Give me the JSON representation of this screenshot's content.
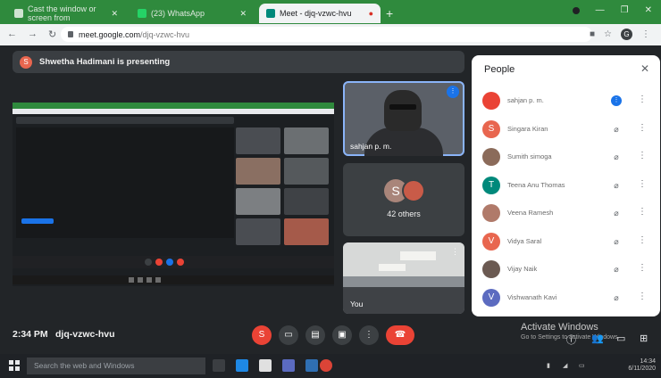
{
  "browser": {
    "tabs": [
      {
        "label": "Cast the window or screen from"
      },
      {
        "label": "(23) WhatsApp"
      },
      {
        "label": "Meet - djq-vzwc-hvu"
      }
    ],
    "url_host": "meet.google.com",
    "url_path": "/djq-vzwc-hvu"
  },
  "meet": {
    "presenting_text": "Shwetha Hadimani is presenting",
    "presenter_initial": "S",
    "tiles": {
      "speaker_name": "sahjan p. m.",
      "others_initial": "S",
      "others_label": "42 others",
      "self_name": "You"
    },
    "time": "2:34 PM",
    "meeting_code": "djq-vzwc-hvu",
    "controls": [
      "caption",
      "camera",
      "present",
      "share",
      "more",
      "hangup"
    ],
    "activate": {
      "title": "Activate Windows",
      "subtitle": "Go to Settings to activate Windows."
    }
  },
  "people": {
    "title": "People",
    "participants": [
      {
        "name": "sahjan p. m.",
        "initial": "",
        "color": "#ea4335",
        "mic": "on"
      },
      {
        "name": "Singara Kiran",
        "initial": "S",
        "color": "#e8664f",
        "mic": "off"
      },
      {
        "name": "Sumith simoga",
        "initial": "",
        "color": "#8b6b5a",
        "mic": "off"
      },
      {
        "name": "Teena Anu Thomas",
        "initial": "T",
        "color": "#00897b",
        "mic": "off"
      },
      {
        "name": "Veena Ramesh",
        "initial": "",
        "color": "#b07a6a",
        "mic": "off"
      },
      {
        "name": "Vidya Saral",
        "initial": "V",
        "color": "#e8664f",
        "mic": "off"
      },
      {
        "name": "Vijay Naik",
        "initial": "",
        "color": "#6b5a52",
        "mic": "off"
      },
      {
        "name": "Vishwanath Kavi",
        "initial": "V",
        "color": "#5c6bc0",
        "mic": "off"
      }
    ]
  },
  "taskbar": {
    "search_placeholder": "Search the web and Windows",
    "clock_time": "14:34",
    "clock_date": "6/11/2020"
  }
}
